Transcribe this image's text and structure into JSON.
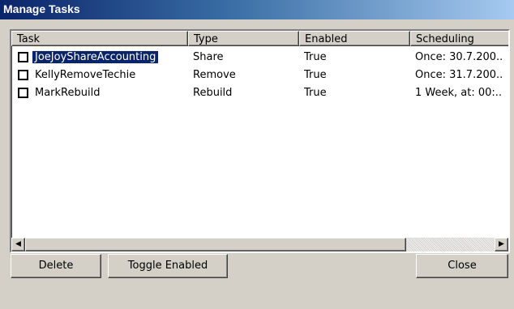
{
  "window": {
    "title": "Manage Tasks"
  },
  "list": {
    "columns": [
      "Task",
      "Type",
      "Enabled",
      "Scheduling"
    ],
    "rows": [
      {
        "task": "JoeJoyShareAccounting",
        "type": "Share",
        "enabled": "True",
        "scheduling": "Once: 30.7.200..",
        "checked": false,
        "selected": true
      },
      {
        "task": "KellyRemoveTechie",
        "type": "Remove",
        "enabled": "True",
        "scheduling": "Once: 31.7.200..",
        "checked": false,
        "selected": false
      },
      {
        "task": "MarkRebuild",
        "type": "Rebuild",
        "enabled": "True",
        "scheduling": "1 Week, at: 00:..",
        "checked": false,
        "selected": false
      }
    ]
  },
  "scrollbar": {
    "left_icon": "arrow-left-icon",
    "right_icon": "arrow-right-icon"
  },
  "buttons": {
    "delete": "Delete",
    "toggle": "Toggle Enabled",
    "close": "Close"
  },
  "colors": {
    "title_bar": "#0a246a",
    "selection": "#0a246a",
    "face": "#d4d0c8"
  }
}
